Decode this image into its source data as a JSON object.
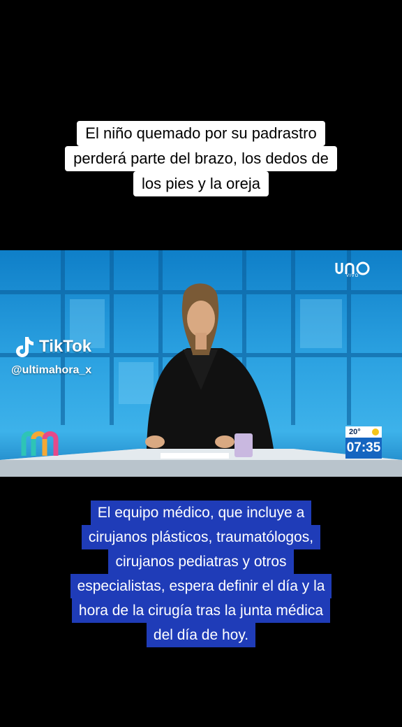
{
  "caption_top": {
    "lines": [
      "El niño quemado por su padrastro",
      "perderá parte del brazo, los dedos de",
      "los pies y la oreja"
    ]
  },
  "video": {
    "tiktok_label": "TikTok",
    "handle": "@ultimahora_x",
    "channel_logo": "uno",
    "channel_sub": "VIVO",
    "weather": {
      "temperature": "20°",
      "time": "07:35"
    }
  },
  "caption_bottom": {
    "lines": [
      "El equipo médico, que incluye a",
      "cirujanos plásticos, traumatólogos,",
      "cirujanos pediatras y otros",
      "especialistas, espera definir el día y la",
      "hora de la cirugía tras la junta médica",
      "del día de hoy."
    ]
  },
  "colors": {
    "background": "#000000",
    "caption_top_bg": "#ffffff",
    "caption_bottom_bg": "#1f3cb8",
    "studio_blue": "#2aa0e0",
    "time_box": "#1565c0"
  }
}
